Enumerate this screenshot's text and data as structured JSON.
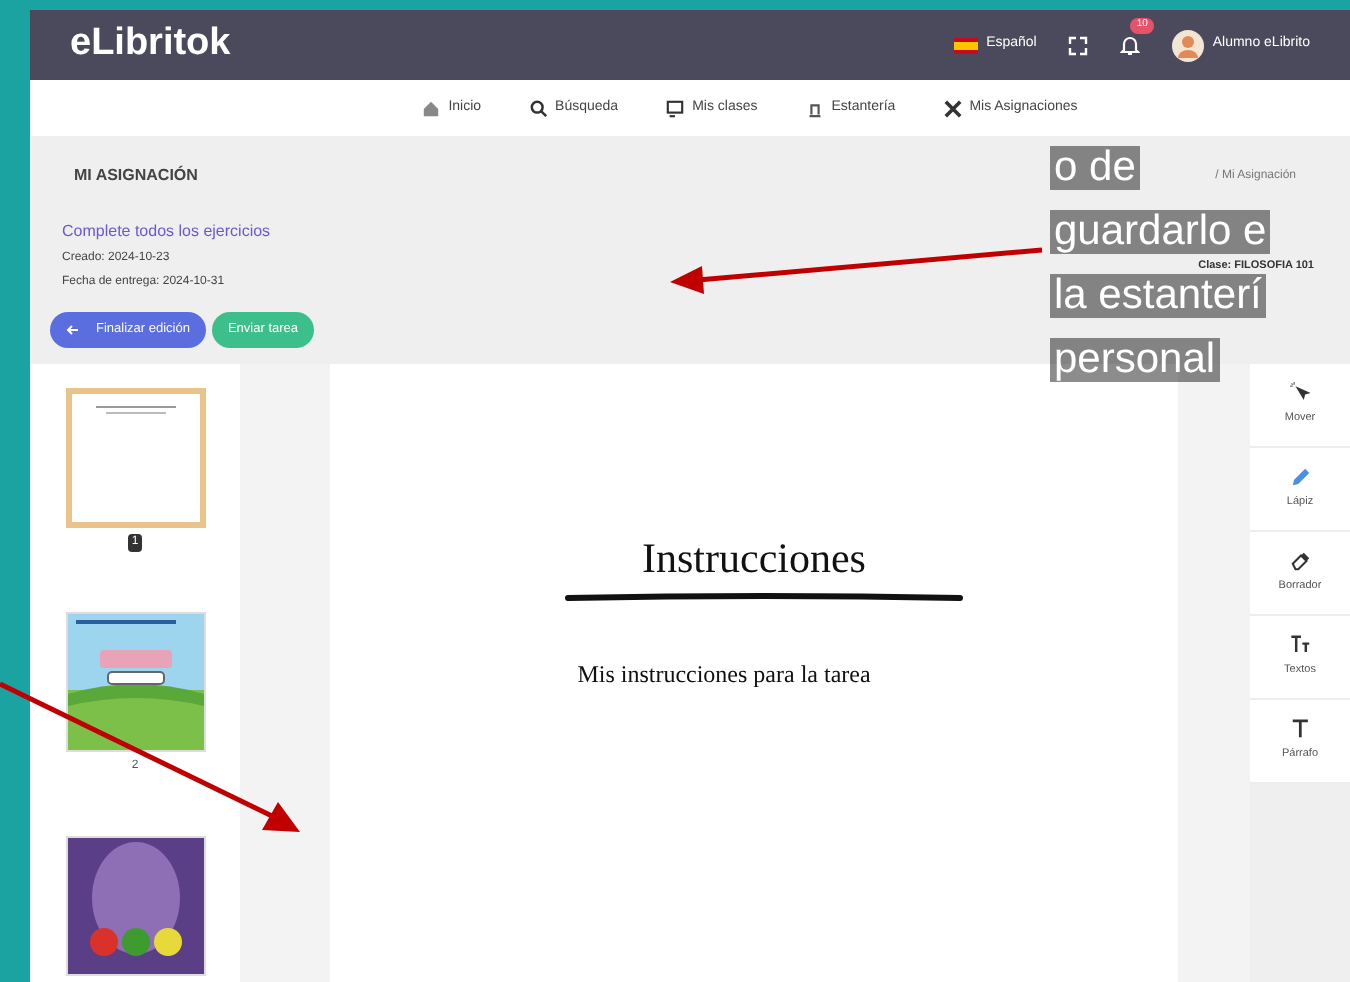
{
  "header": {
    "logo": "eLibritok",
    "language": "Español",
    "notification_count": "10",
    "user": "Alumno eLibrito"
  },
  "nav": [
    {
      "label": "Inicio"
    },
    {
      "label": "Búsqueda"
    },
    {
      "label": "Mis clases"
    },
    {
      "label": "Estantería"
    },
    {
      "label": "Mis Asignaciones"
    }
  ],
  "page_title": "MI ASIGNACIÓN",
  "breadcrumb": "/ Mi Asignación",
  "assignment": {
    "title": "Complete todos los ejercicios",
    "created": "Creado: 2024-10-23",
    "due": "Fecha de entrega: 2024-10-31",
    "class": "Clase: FILOSOFIA 101"
  },
  "buttons": [
    {
      "label": "Finalizar edición",
      "kind": "back"
    },
    {
      "label": "Enviar tarea",
      "kind": "send"
    }
  ],
  "thumbnails": [
    {
      "kind": "document",
      "label": "1",
      "selected": true
    },
    {
      "kind": "picture",
      "label": "2",
      "selected": false
    },
    {
      "kind": "picture",
      "selected": false
    }
  ],
  "document": {
    "heading": "Instrucciones",
    "body": "Mis instrucciones para la tarea"
  },
  "tools": [
    {
      "label": "Mover"
    },
    {
      "label": "Lápiz"
    },
    {
      "label": "Borrador"
    },
    {
      "label": "Textos"
    },
    {
      "label": "Párrafo"
    }
  ],
  "caption": [
    "o de",
    "guardarlo e",
    "la estanterí",
    "personal"
  ]
}
